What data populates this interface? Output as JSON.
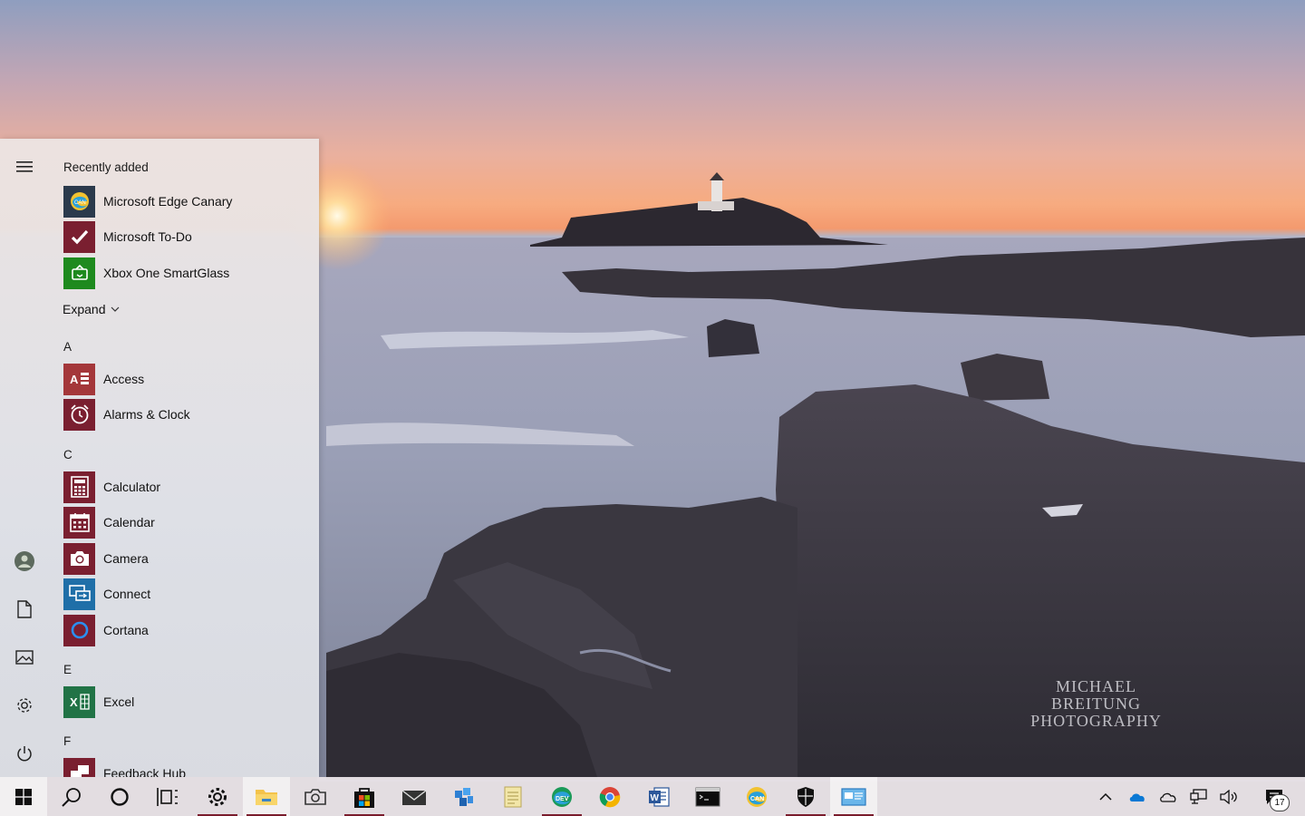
{
  "wallpaper": {
    "watermark_line1": "MICHAEL BREITUNG",
    "watermark_line2": "PHOTOGRAPHY"
  },
  "start_menu": {
    "recently_added_label": "Recently added",
    "recent_apps": [
      {
        "name": "Microsoft Edge Canary",
        "icon": "edge-canary-icon",
        "tile_color": "#2b3a4c"
      },
      {
        "name": "Microsoft To-Do",
        "icon": "todo-check-icon",
        "tile_color": "#7a1f30"
      },
      {
        "name": "Xbox One SmartGlass",
        "icon": "xbox-smartglass-icon",
        "tile_color": "#1e8a1e"
      }
    ],
    "expand_label": "Expand",
    "groups": [
      {
        "letter": "A",
        "apps": [
          {
            "name": "Access",
            "icon": "access-icon",
            "tile_color": "#a4373a"
          },
          {
            "name": "Alarms & Clock",
            "icon": "alarm-clock-icon",
            "tile_color": "#7a1f30"
          }
        ]
      },
      {
        "letter": "C",
        "apps": [
          {
            "name": "Calculator",
            "icon": "calculator-icon",
            "tile_color": "#7a1f30"
          },
          {
            "name": "Calendar",
            "icon": "calendar-icon",
            "tile_color": "#7a1f30"
          },
          {
            "name": "Camera",
            "icon": "camera-icon",
            "tile_color": "#7a1f30"
          },
          {
            "name": "Connect",
            "icon": "connect-icon",
            "tile_color": "#1f6fa8"
          },
          {
            "name": "Cortana",
            "icon": "cortana-icon",
            "tile_color": "#7a1f30"
          }
        ]
      },
      {
        "letter": "E",
        "apps": [
          {
            "name": "Excel",
            "icon": "excel-icon",
            "tile_color": "#217346"
          }
        ]
      },
      {
        "letter": "F",
        "apps": [
          {
            "name": "Feedback Hub",
            "icon": "feedback-hub-icon",
            "tile_color": "#7a1f30"
          }
        ]
      }
    ],
    "rail": [
      "hamburger-icon",
      "user-avatar-icon",
      "documents-icon",
      "pictures-icon",
      "settings-icon",
      "power-icon"
    ]
  },
  "taskbar": {
    "buttons": [
      "start",
      "search",
      "cortana",
      "task-view",
      "settings",
      "file-explorer",
      "camera",
      "store",
      "mail",
      "app-package",
      "notepad",
      "edge-dev",
      "chrome",
      "word",
      "terminal",
      "edge-canary",
      "windows-security",
      "control-panel"
    ],
    "tray": [
      "show-hidden-icons",
      "onedrive",
      "onedrive-personal",
      "network",
      "volume"
    ],
    "notification_count": "17"
  },
  "colors": {
    "accent": "#7a1f30",
    "taskbar": "#e8e2e6"
  }
}
